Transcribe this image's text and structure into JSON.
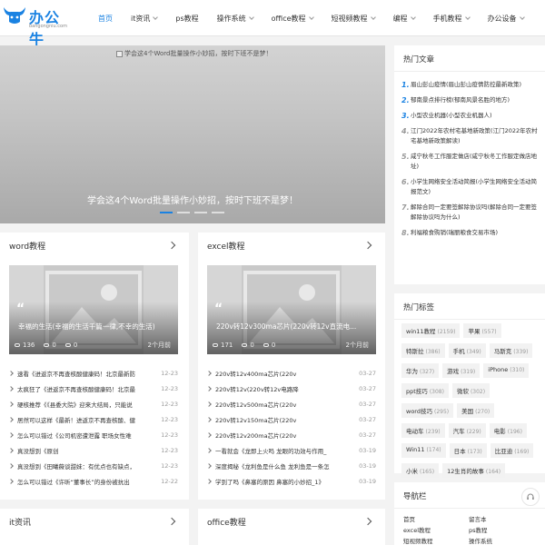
{
  "brand": {
    "name": "办公牛",
    "url": "bangongniu.com"
  },
  "nav": [
    {
      "label": "首页",
      "active": true,
      "has_menu": false
    },
    {
      "label": "it资讯",
      "active": false,
      "has_menu": true
    },
    {
      "label": "ps教程",
      "active": false,
      "has_menu": false
    },
    {
      "label": "操作系统",
      "active": false,
      "has_menu": true
    },
    {
      "label": "office教程",
      "active": false,
      "has_menu": true
    },
    {
      "label": "短视频教程",
      "active": false,
      "has_menu": true
    },
    {
      "label": "编程",
      "active": false,
      "has_menu": true
    },
    {
      "label": "手机教程",
      "active": false,
      "has_menu": true
    },
    {
      "label": "办公设备",
      "active": false,
      "has_menu": true
    }
  ],
  "slider": {
    "image_alt": "学会这4个Word批量操作小妙招，按时下班不是梦！",
    "caption": "学会这4个Word批量操作小妙招，按时下班不是梦！",
    "slide_count": 4,
    "active_slide": 1
  },
  "cards": [
    {
      "title": "word教程",
      "feature": {
        "title": "幸福的生活(幸福的生活千篇一律,不幸的生活)",
        "views": "136",
        "comments": "0",
        "likes": "0",
        "date": "2个月前"
      },
      "items": [
        {
          "title": "速看《进返京不再查核酸健康码！北京最新防",
          "date": "12-23"
        },
        {
          "title": "太疯狂了《进返京不再查核酸健康码！北京最",
          "date": "12-23"
        },
        {
          "title": "硬核推荐《《县委大院》迎来大结局，只能说",
          "date": "12-23"
        },
        {
          "title": "居然可以这样《最新！进返京不再查核酸、健",
          "date": "12-23"
        },
        {
          "title": "怎么可以错过《公司机密遭泄露 职场女性难",
          "date": "12-23"
        },
        {
          "title": "真没想到《原创",
          "date": "12-23"
        },
        {
          "title": "真没想到《田曦薇谈甜妹：有优点也有缺点，",
          "date": "12-23"
        },
        {
          "title": "怎么可以错过《许昕“董事长”的身份被抗出",
          "date": "12-22"
        }
      ]
    },
    {
      "title": "excel教程",
      "feature": {
        "title": "220v转12v300ma芯片(220v转12v直流电...",
        "views": "171",
        "comments": "0",
        "likes": "0",
        "date": "2个月前"
      },
      "items": [
        {
          "title": "220v转12v400ma芯片(220v",
          "date": "03-27"
        },
        {
          "title": "220v转12v(220v转12v电路降",
          "date": "03-27"
        },
        {
          "title": "220v转12v500ma芯片(220v",
          "date": "03-27"
        },
        {
          "title": "220v转12v150ma芯片(220v",
          "date": "03-27"
        },
        {
          "title": "220v转12v200ma芯片(220v",
          "date": "03-27"
        },
        {
          "title": "一看就会《龙即上火吗 龙眼的功效与作用_",
          "date": "03-19"
        },
        {
          "title": "深度揭秘《龙利鱼是什么鱼 龙利鱼是一条怎",
          "date": "03-19"
        },
        {
          "title": "学到了吗《鼻塞的原因 鼻塞的小妙招_1》",
          "date": "03-19"
        }
      ]
    }
  ],
  "bottom_cards": [
    "it资讯",
    "office教程"
  ],
  "hot_articles": {
    "title": "热门文章",
    "items": [
      "眉山彭山疫情(眉山彭山疫情防控最新政策)",
      "郁南景点排行榜(郁南风景名胜的地方)",
      "小型农业机器(小型农业机器人)",
      "江门2022年农村宅基地新政策(江门2022年农村宅基地新政策解读)",
      "咸宁秋冬工作服定做店(咸宁秋冬工作服定做店地址)",
      "小学生网络安全活动简报(小学生网络安全活动简报范文)",
      "解除合同一定要签解除协议吗(解除合同一定要签解除协议吗为什么)",
      "利福粮食购销(瑞丽粮食交易市场)"
    ]
  },
  "hot_tags": {
    "title": "热门标签",
    "items": [
      {
        "name": "win11教程",
        "count": "(2159)"
      },
      {
        "name": "苹果",
        "count": "(557)"
      },
      {
        "name": "特斯拉",
        "count": "(386)"
      },
      {
        "name": "手机",
        "count": "(349)"
      },
      {
        "name": "马斯克",
        "count": "(339)"
      },
      {
        "name": "华为",
        "count": "(327)"
      },
      {
        "name": "游戏",
        "count": "(319)"
      },
      {
        "name": "iPhone",
        "count": "(310)"
      },
      {
        "name": "ppt技巧",
        "count": "(308)"
      },
      {
        "name": "微软",
        "count": "(302)"
      },
      {
        "name": "word技巧",
        "count": "(295)"
      },
      {
        "name": "美国",
        "count": "(270)"
      },
      {
        "name": "电动车",
        "count": "(239)"
      },
      {
        "name": "汽车",
        "count": "(229)"
      },
      {
        "name": "电影",
        "count": "(196)"
      },
      {
        "name": "Win11",
        "count": "(174)"
      },
      {
        "name": "日本",
        "count": "(173)"
      },
      {
        "name": "比亚迪",
        "count": "(169)"
      },
      {
        "name": "小米",
        "count": "(165)"
      },
      {
        "name": "12生肖的故事",
        "count": "(164)"
      }
    ]
  },
  "nav_panel": {
    "title": "导航栏",
    "items": [
      "首页",
      "留言本",
      "excel教程",
      "ps教程",
      "短视频教程",
      "操作系统"
    ]
  },
  "colors": {
    "accent": "#1a82e2",
    "background": "#f3f3f3"
  }
}
